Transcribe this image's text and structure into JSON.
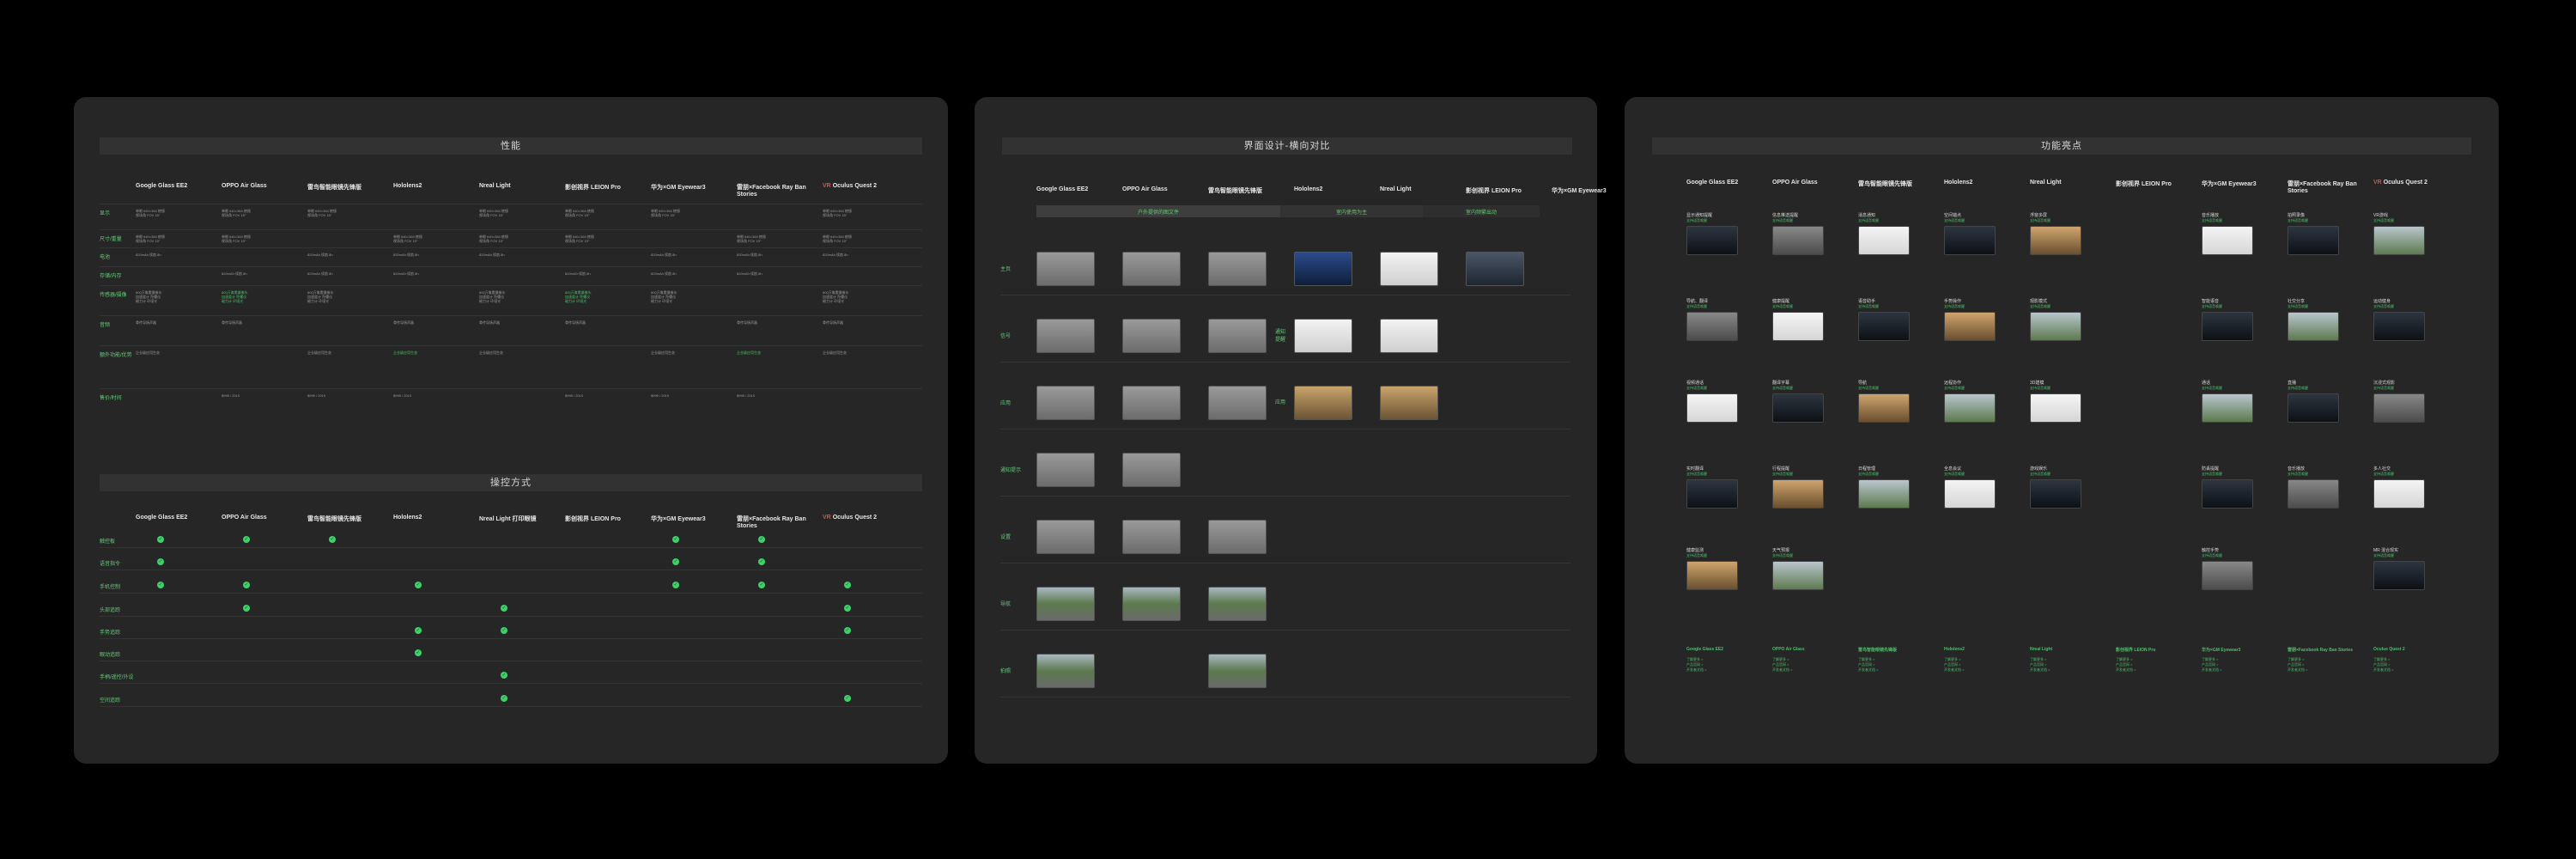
{
  "devices": [
    {
      "name": "Google Glass EE2",
      "prefix": ""
    },
    {
      "name": "OPPO Air Glass",
      "prefix": ""
    },
    {
      "name": "雷鸟智能眼镜先锋版",
      "prefix": ""
    },
    {
      "name": "Hololens2",
      "prefix": ""
    },
    {
      "name": "Nreal Light",
      "prefix": ""
    },
    {
      "name": "影创视界 LEION Pro",
      "prefix": ""
    },
    {
      "name": "华为×GM Eyewear3",
      "prefix": ""
    },
    {
      "name": "雷朋×Facebook Ray Ban Stories",
      "prefix": ""
    },
    {
      "name": "Oculus Quest 2",
      "prefix": "VR"
    }
  ],
  "panel1": {
    "perf_title": "性能",
    "perf_rows": [
      "显示",
      "尺寸/重量",
      "电池",
      "存储/内存",
      "传感器/摄像",
      "音频",
      "额外功能/优势",
      "售价/时间"
    ],
    "ctrl_title": "操控方式",
    "ctrl_col5": "Nreal Light 打印眼镜",
    "ctrl_rows": [
      "触控板",
      "语音指令",
      "手机控制",
      "头部追踪",
      "手势追踪",
      "眼动追踪",
      "手柄/遥控/外设",
      "空间追踪"
    ],
    "cell_samples": {
      "display": "单眼 640×360 棱镜\n视场角 FOV 15°",
      "battery": "820mAh 续航 8h",
      "sensors": "800万像素摄像头\n加速度计 陀螺仪\n磁力计 环境光",
      "audio": "骨传导扬声器",
      "extra": "企业级应用生态",
      "price": "$999 / 2019"
    }
  },
  "panel2": {
    "title": "界面设计-横向对比",
    "segments": [
      "户外提供的图文件",
      "室内使用为主",
      "室内频繁出动"
    ],
    "rows": [
      "主页",
      "信号",
      "应用",
      "通知提示",
      "设置",
      "导航",
      "拍照"
    ],
    "side_labels": {
      "signal": "通知\n提醒",
      "app": "应用"
    }
  },
  "panel3": {
    "title": "功能亮点",
    "feature_titles": [
      [
        "显示通知提醒",
        "信息推送提醒",
        "消息通知",
        "空间锚点",
        "浮窗多屏",
        "",
        "音乐播放",
        "拍照录像",
        "VR游戏"
      ],
      [
        "导航、翻译",
        "健康提醒",
        "语音助手",
        "手势操作",
        "观影模式",
        "",
        "智能语音",
        "社交分享",
        "运动健身"
      ],
      [
        "视频通话",
        "翻译字幕",
        "导航",
        "远程协作",
        "3D建模",
        "",
        "通话",
        "直播",
        "沉浸式观影"
      ],
      [
        "实时翻译",
        "行程提醒",
        "日程管理",
        "全息会议",
        "游戏娱乐",
        "",
        "防丢提醒",
        "音乐播放",
        "多人社交"
      ],
      [
        "健康监测",
        "天气预报",
        "",
        "",
        "",
        "",
        "触控手势",
        "",
        "MR 混合现实"
      ]
    ],
    "feature_sub": "支持语音唤醒",
    "footer_links": "了解更多 >\n产品官网 >\n开发者文档 >"
  },
  "colors": {
    "accent": "#4fbf6b",
    "panel": "#262626",
    "bg": "#000000",
    "vr_red": "#e64b3c"
  }
}
